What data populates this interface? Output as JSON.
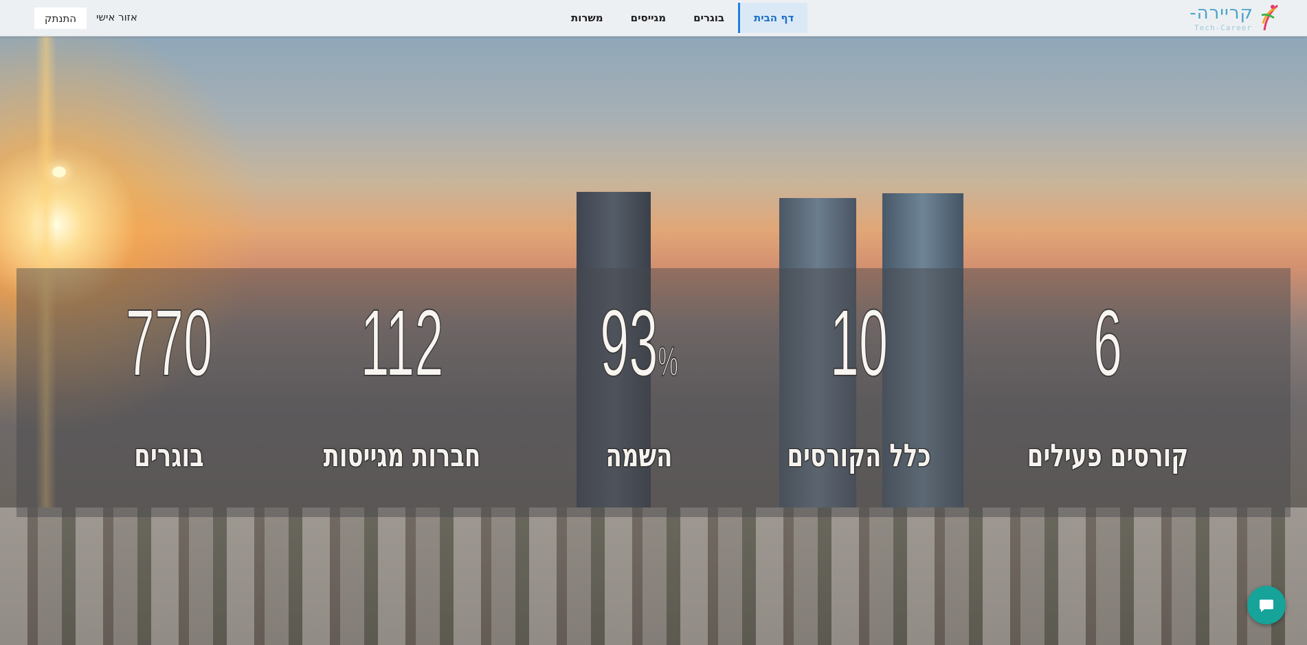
{
  "header": {
    "logo": {
      "text": "קריירה-",
      "subtext": "Tech-Career"
    },
    "nav": [
      {
        "label": "דף הבית",
        "active": true
      },
      {
        "label": "בוגרים",
        "active": false
      },
      {
        "label": "מגייסים",
        "active": false
      },
      {
        "label": "משרות",
        "active": false
      }
    ],
    "personal_area": "אזור אישי",
    "disconnect": "התנתק"
  },
  "stats": [
    {
      "value": "6",
      "label": "קורסים פעילים"
    },
    {
      "value": "10",
      "label": "כלל הקורסים"
    },
    {
      "value": "93",
      "suffix": "%",
      "label": "השמה"
    },
    {
      "value": "112",
      "label": "חברות מגייסות"
    },
    {
      "value": "770",
      "label": "בוגרים"
    }
  ],
  "colors": {
    "accent": "#1d7fe0",
    "chat": "#16a39a"
  },
  "chat": {
    "icon": "chat-bubble-icon"
  }
}
